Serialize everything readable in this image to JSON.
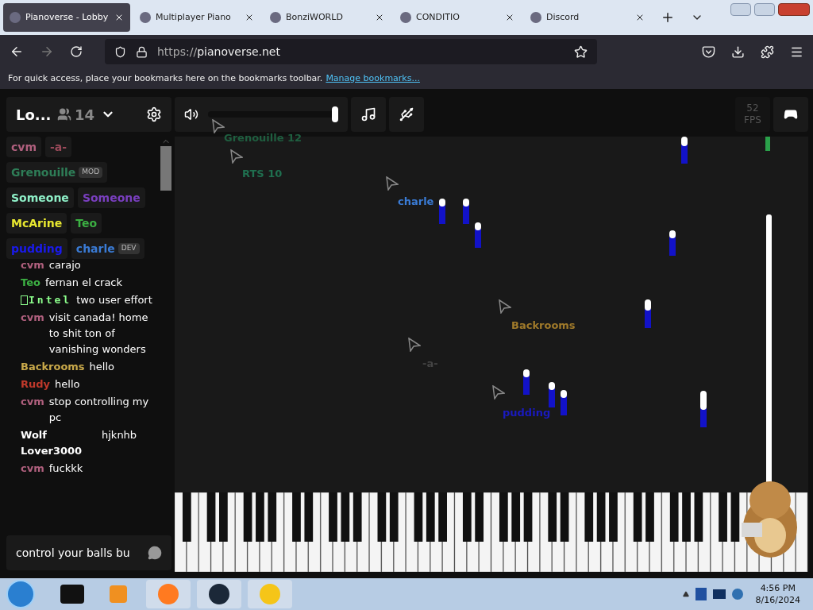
{
  "browser": {
    "tabs": [
      {
        "title": "Pianoverse - Lobby",
        "selected": true
      },
      {
        "title": "Multiplayer Piano",
        "selected": false
      },
      {
        "title": "BonziWORLD",
        "selected": false
      },
      {
        "title": "CONDITIO",
        "selected": false
      },
      {
        "title": "Discord",
        "selected": false
      }
    ],
    "url_scheme": "https://",
    "url_host": "pianoverse.net",
    "bookmarks_hint": "For quick access, place your bookmarks here on the bookmarks toolbar.",
    "bookmarks_link": "Manage bookmarks..."
  },
  "room": {
    "name": "Lo...",
    "user_count": "14"
  },
  "users": [
    {
      "name": "cvm",
      "color": "#b0607e"
    },
    {
      "name": "-a-",
      "color": "#9a4a5a"
    },
    {
      "name": "Grenouille",
      "color": "#2e7d57",
      "badge": "MOD"
    },
    {
      "name": "Someone",
      "color": "#8ff0c8"
    },
    {
      "name": "Someone",
      "color": "#7a3fc0"
    },
    {
      "name": "McArine",
      "color": "#e8e830"
    },
    {
      "name": "Teo",
      "color": "#3cb043"
    },
    {
      "name": "pudding",
      "color": "#1a1aee"
    },
    {
      "name": "charle",
      "color": "#3a7bd5",
      "badge": "DEV"
    }
  ],
  "chat": [
    {
      "name": "cvm",
      "color": "#b0607e",
      "kind": "plain",
      "text": "carajo"
    },
    {
      "name": "Teo",
      "color": "#3cb043",
      "kind": "plain",
      "text": "fernan el crack"
    },
    {
      "name": "Intel",
      "color": "#8cff8c",
      "kind": "mono",
      "text": "two user effort"
    },
    {
      "name": "cvm",
      "color": "#b0607e",
      "kind": "plain",
      "text": "visit canada! home to shit ton of vanishing wonders"
    },
    {
      "name": "Backrooms",
      "color": "#c9a94a",
      "kind": "plain",
      "text": "hello"
    },
    {
      "name": "Rudy",
      "color": "#c0392b",
      "kind": "plain",
      "text": "hello"
    },
    {
      "name": "cvm",
      "color": "#b0607e",
      "kind": "plain",
      "text": "stop controlling my pc"
    },
    {
      "name": "Wolf Lover3000",
      "color": "#ffffff",
      "kind": "plain",
      "text": "hjknhb"
    },
    {
      "name": "cvm",
      "color": "#b0607e",
      "kind": "plain",
      "text": "fuckkk"
    }
  ],
  "chat_input": {
    "value": "control your balls bu"
  },
  "toolbar": {
    "volume": {
      "level": 1
    },
    "fps": "52",
    "fps_label": "FPS"
  },
  "cursors": [
    {
      "name": "Grenouille 12",
      "color": "#1f5f40"
    },
    {
      "name": "RTS 10",
      "color": "#1f6f4f"
    },
    {
      "name": "charle",
      "color": "#3a7bd5"
    },
    {
      "name": "Backrooms",
      "color": "#a07a2a"
    },
    {
      "name": "-a-",
      "color": "#444444"
    },
    {
      "name": "pudding",
      "color": "#1a1ac0"
    }
  ],
  "taskbar": {
    "time": "4:56 PM",
    "date": "8/16/2024"
  }
}
